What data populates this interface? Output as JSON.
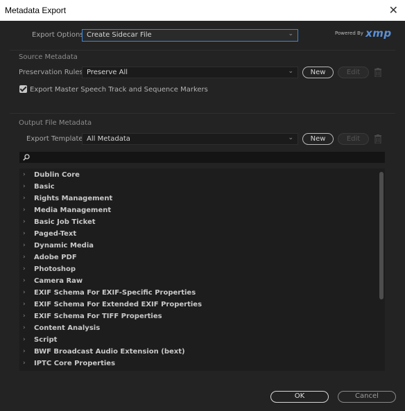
{
  "window": {
    "title": "Metadata Export",
    "close_glyph": "✕"
  },
  "export_options": {
    "label": "Export Options:",
    "value": "Create Sidecar File"
  },
  "branding": {
    "powered_by": "Powered By",
    "logo": "xmp",
    "accent": "#5b90d6"
  },
  "source_metadata": {
    "title": "Source Metadata",
    "preservation_label": "Preservation Rules:",
    "preservation_value": "Preserve All",
    "new_label": "New",
    "edit_label": "Edit",
    "checkbox_label": "Export Master Speech Track and Sequence Markers",
    "checkbox_checked": true
  },
  "output_metadata": {
    "title": "Output File Metadata",
    "template_label": "Export Template:",
    "template_value": "All Metadata",
    "new_label": "New",
    "edit_label": "Edit",
    "search_placeholder": "",
    "items": [
      "Dublin Core",
      "Basic",
      "Rights Management",
      "Media Management",
      "Basic Job Ticket",
      "Paged-Text",
      "Dynamic Media",
      "Adobe PDF",
      "Photoshop",
      "Camera Raw",
      "EXIF Schema For EXIF-Specific Properties",
      "EXIF Schema For Extended EXIF Properties",
      "EXIF Schema For TIFF Properties",
      "Content Analysis",
      "Script",
      "BWF Broadcast Audio Extension (bext)",
      "IPTC Core Properties"
    ]
  },
  "footer": {
    "ok_label": "OK",
    "cancel_label": "Cancel"
  }
}
